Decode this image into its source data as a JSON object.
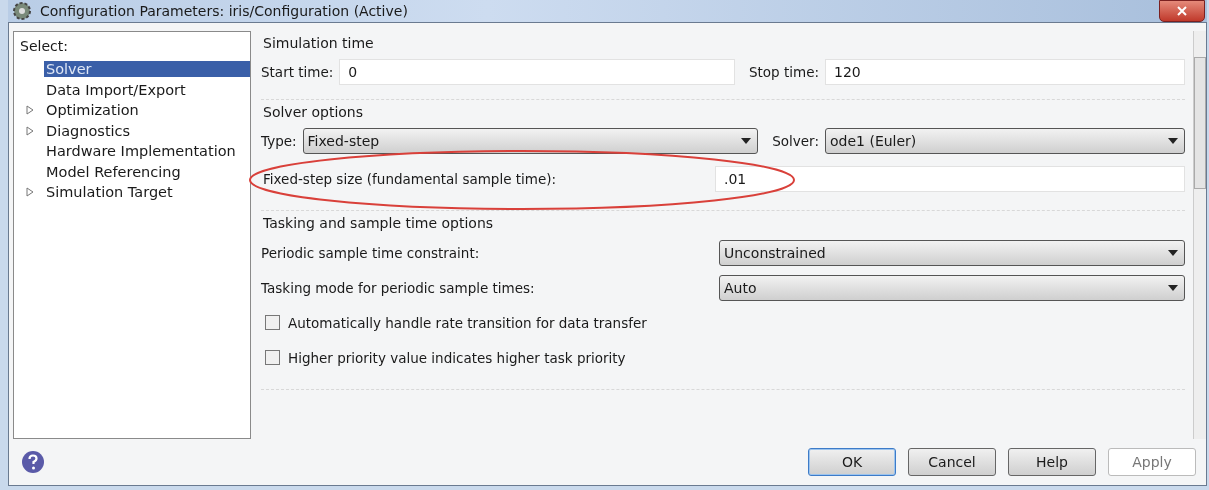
{
  "window": {
    "title": "Configuration Parameters: iris/Configuration (Active)"
  },
  "tree": {
    "label": "Select:",
    "items": [
      {
        "label": "Solver",
        "selected": true,
        "expandable": false
      },
      {
        "label": "Data Import/Export",
        "selected": false,
        "expandable": false
      },
      {
        "label": "Optimization",
        "selected": false,
        "expandable": true
      },
      {
        "label": "Diagnostics",
        "selected": false,
        "expandable": true
      },
      {
        "label": "Hardware Implementation",
        "selected": false,
        "expandable": false
      },
      {
        "label": "Model Referencing",
        "selected": false,
        "expandable": false
      },
      {
        "label": "Simulation Target",
        "selected": false,
        "expandable": true
      }
    ]
  },
  "simulation_time": {
    "title": "Simulation time",
    "start_label": "Start time:",
    "start_value": "0",
    "stop_label": "Stop time:",
    "stop_value": "120"
  },
  "solver_options": {
    "title": "Solver options",
    "type_label": "Type:",
    "type_value": "Fixed-step",
    "solver_label": "Solver:",
    "solver_value": "ode1 (Euler)",
    "step_label": "Fixed-step size (fundamental sample time):",
    "step_value": ".01"
  },
  "tasking": {
    "title": "Tasking and sample time options",
    "rows": [
      {
        "kind": "dropdown",
        "label": "Periodic sample time constraint:",
        "value": "Unconstrained"
      },
      {
        "kind": "dropdown",
        "label": "Tasking mode for periodic sample times:",
        "value": "Auto"
      },
      {
        "kind": "checkbox",
        "label": "Automatically handle rate transition for data transfer",
        "checked": false
      },
      {
        "kind": "checkbox",
        "label": "Higher priority value indicates higher task priority",
        "checked": false
      }
    ]
  },
  "buttons": [
    {
      "label": "OK",
      "default": true,
      "disabled": false
    },
    {
      "label": "Cancel",
      "default": false,
      "disabled": false
    },
    {
      "label": "Help",
      "default": false,
      "disabled": false
    },
    {
      "label": "Apply",
      "default": false,
      "disabled": true
    }
  ]
}
